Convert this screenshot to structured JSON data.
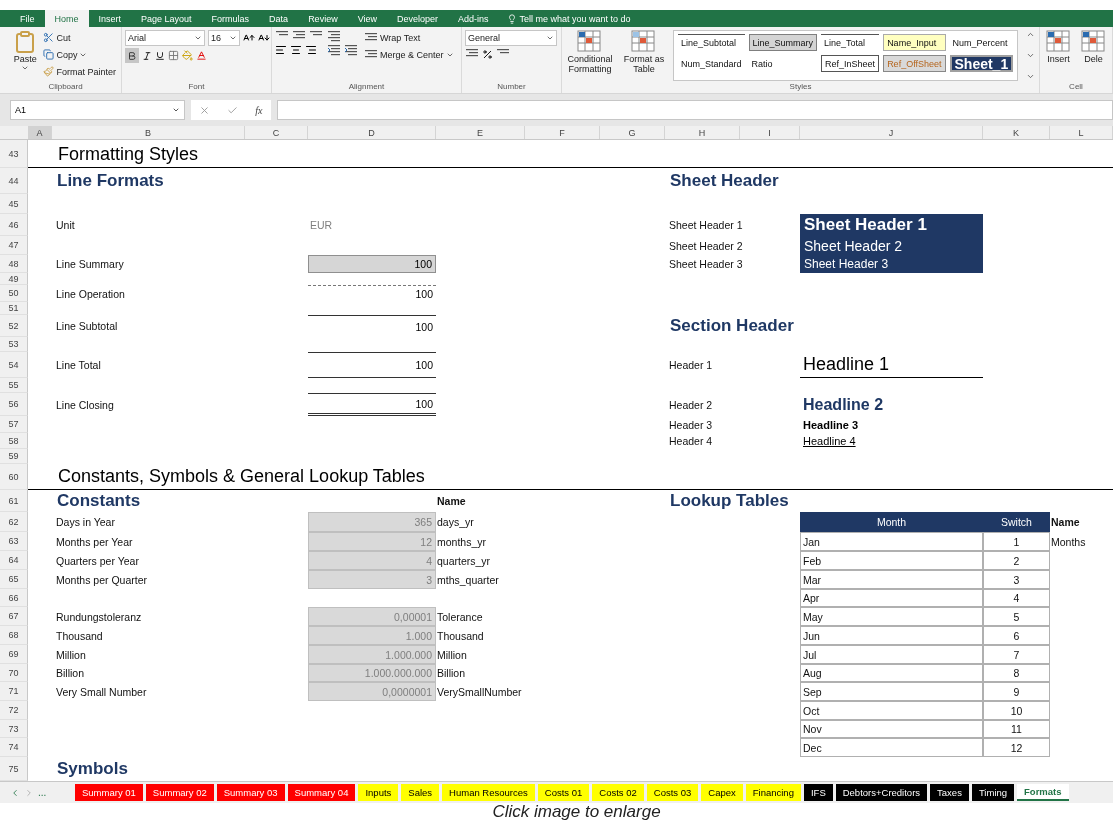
{
  "ribbon": {
    "tabs": [
      {
        "label": "File",
        "selected": false
      },
      {
        "label": "Home",
        "selected": true
      },
      {
        "label": "Insert",
        "selected": false
      },
      {
        "label": "Page Layout",
        "selected": false
      },
      {
        "label": "Formulas",
        "selected": false
      },
      {
        "label": "Data",
        "selected": false
      },
      {
        "label": "Review",
        "selected": false
      },
      {
        "label": "View",
        "selected": false
      },
      {
        "label": "Developer",
        "selected": false
      },
      {
        "label": "Add-ins",
        "selected": false
      }
    ],
    "tell_me": "Tell me what you want to do",
    "clipboard": {
      "paste": "Paste",
      "cut": "Cut",
      "copy": "Copy",
      "format_painter": "Format Painter",
      "label": "Clipboard"
    },
    "font": {
      "name": "Arial",
      "size": "16",
      "bold": true,
      "label": "Font"
    },
    "alignment": {
      "wrap": "Wrap Text",
      "merge": "Merge & Center",
      "label": "Alignment"
    },
    "number": {
      "format": "General",
      "label": "Number"
    },
    "styles": {
      "conditional": "Conditional Formatting",
      "format_table": "Format as Table",
      "label": "Styles",
      "gallery": [
        {
          "label": "Line_Subtotal",
          "kind": "topline"
        },
        {
          "label": "Line_Summary",
          "kind": "grey"
        },
        {
          "label": "Line_Total",
          "kind": "topline"
        },
        {
          "label": "Name_Input",
          "kind": "input"
        },
        {
          "label": "Num_Percent",
          "kind": "plain"
        },
        {
          "label": "Num_Standard",
          "kind": "plain"
        },
        {
          "label": "Ratio",
          "kind": "plain"
        },
        {
          "label": "Ref_InSheet",
          "kind": "boxed"
        },
        {
          "label": "Ref_OffSheet",
          "kind": "offsheet"
        },
        {
          "label": "Sheet_1",
          "kind": "sheet"
        }
      ]
    },
    "cells": {
      "insert": "Insert",
      "delete": "Dele",
      "label": "Cell"
    }
  },
  "formula_bar": {
    "name_box": "A1",
    "fx": "fx"
  },
  "columns": [
    "A",
    "B",
    "C",
    "D",
    "E",
    "F",
    "G",
    "H",
    "I",
    "J",
    "K",
    "L"
  ],
  "rows": [
    {
      "num": "43",
      "A": {
        "kind": "title",
        "text": "Formatting Styles"
      }
    },
    {
      "num": "44",
      "B": {
        "kind": "heading",
        "text": "Line Formats"
      },
      "H": {
        "kind": "heading",
        "text": "Sheet Header"
      }
    },
    {
      "num": "45"
    },
    {
      "num": "46",
      "B": {
        "kind": "label",
        "text": "Unit"
      },
      "D": {
        "kind": "unit",
        "text": "EUR"
      },
      "H": {
        "kind": "label",
        "text": "Sheet Header 1"
      },
      "J": {
        "kind": "sheet1",
        "text": "Sheet Header 1"
      }
    },
    {
      "num": "47",
      "H": {
        "kind": "label",
        "text": "Sheet Header 2"
      },
      "J": {
        "kind": "sheet2",
        "text": "Sheet Header 2"
      }
    },
    {
      "num": "48",
      "B": {
        "kind": "label",
        "text": "Line Summary"
      },
      "D": {
        "kind": "summary",
        "text": "100"
      },
      "H": {
        "kind": "label",
        "text": "Sheet Header 3"
      },
      "J": {
        "kind": "sheet3",
        "text": "Sheet Header 3"
      }
    },
    {
      "num": "49"
    },
    {
      "num": "50",
      "B": {
        "kind": "label",
        "text": "Line Operation"
      },
      "D": {
        "kind": "operation",
        "text": "100"
      }
    },
    {
      "num": "51"
    },
    {
      "num": "52",
      "B": {
        "kind": "label",
        "text": "Line Subtotal"
      },
      "D": {
        "kind": "subtotal",
        "text": "100"
      },
      "H": {
        "kind": "heading",
        "text": "Section Header"
      }
    },
    {
      "num": "53"
    },
    {
      "num": "54",
      "B": {
        "kind": "label",
        "text": "Line Total"
      },
      "D": {
        "kind": "total",
        "text": "100"
      },
      "H": {
        "kind": "label",
        "text": "Header 1"
      },
      "J": {
        "kind": "headline1",
        "text": "Headline 1"
      }
    },
    {
      "num": "55"
    },
    {
      "num": "56",
      "B": {
        "kind": "label",
        "text": "Line Closing"
      },
      "D": {
        "kind": "closing",
        "text": "100"
      },
      "H": {
        "kind": "label",
        "text": "Header 2"
      },
      "J": {
        "kind": "headline2",
        "text": "Headline 2"
      }
    },
    {
      "num": "57",
      "H": {
        "kind": "label",
        "text": "Header 3"
      },
      "J": {
        "kind": "headline3",
        "text": "Headline 3"
      }
    },
    {
      "num": "58",
      "H": {
        "kind": "label",
        "text": "Header 4"
      },
      "J": {
        "kind": "headline4",
        "text": "Headline 4"
      }
    },
    {
      "num": "59"
    },
    {
      "num": "60",
      "A": {
        "kind": "title",
        "text": "Constants, Symbols & General Lookup Tables"
      }
    },
    {
      "num": "61",
      "B": {
        "kind": "heading",
        "text": "Constants"
      },
      "E": {
        "kind": "bold",
        "text": "Name"
      },
      "H": {
        "kind": "heading",
        "text": "Lookup Tables"
      }
    },
    {
      "num": "62",
      "B": {
        "kind": "label",
        "text": "Days in Year"
      },
      "D": {
        "kind": "constant",
        "text": "365"
      },
      "E": {
        "kind": "name",
        "text": "days_yr"
      },
      "J": {
        "kind": "thead",
        "text": "Month"
      },
      "K": {
        "kind": "thead",
        "text": "Switch"
      },
      "L": {
        "kind": "bold",
        "text": "Name"
      }
    },
    {
      "num": "63",
      "B": {
        "kind": "label",
        "text": "Months per Year"
      },
      "D": {
        "kind": "constant",
        "text": "12"
      },
      "E": {
        "kind": "name",
        "text": "months_yr"
      },
      "J": {
        "kind": "tcell",
        "text": "Jan"
      },
      "K": {
        "kind": "tnum",
        "text": "1"
      },
      "L": {
        "kind": "name",
        "text": "Months"
      }
    },
    {
      "num": "64",
      "B": {
        "kind": "label",
        "text": "Quarters per Year"
      },
      "D": {
        "kind": "constant",
        "text": "4"
      },
      "E": {
        "kind": "name",
        "text": "quarters_yr"
      },
      "J": {
        "kind": "tcell",
        "text": "Feb"
      },
      "K": {
        "kind": "tnum",
        "text": "2"
      }
    },
    {
      "num": "65",
      "B": {
        "kind": "label",
        "text": "Months per Quarter"
      },
      "D": {
        "kind": "constant",
        "text": "3"
      },
      "E": {
        "kind": "name",
        "text": "mths_quarter"
      },
      "J": {
        "kind": "tcell",
        "text": "Mar"
      },
      "K": {
        "kind": "tnum",
        "text": "3"
      }
    },
    {
      "num": "66",
      "J": {
        "kind": "tcell",
        "text": "Apr"
      },
      "K": {
        "kind": "tnum",
        "text": "4"
      }
    },
    {
      "num": "67",
      "B": {
        "kind": "label",
        "text": "Rundungstoleranz"
      },
      "D": {
        "kind": "constant",
        "text": "0,00001"
      },
      "E": {
        "kind": "name",
        "text": "Tolerance"
      },
      "J": {
        "kind": "tcell",
        "text": "May"
      },
      "K": {
        "kind": "tnum",
        "text": "5"
      }
    },
    {
      "num": "68",
      "B": {
        "kind": "label",
        "text": "Thousand"
      },
      "D": {
        "kind": "constant",
        "text": "1.000"
      },
      "E": {
        "kind": "name",
        "text": "Thousand"
      },
      "J": {
        "kind": "tcell",
        "text": "Jun"
      },
      "K": {
        "kind": "tnum",
        "text": "6"
      }
    },
    {
      "num": "69",
      "B": {
        "kind": "label",
        "text": "Million"
      },
      "D": {
        "kind": "constant",
        "text": "1.000.000"
      },
      "E": {
        "kind": "name",
        "text": "Million"
      },
      "J": {
        "kind": "tcell",
        "text": "Jul"
      },
      "K": {
        "kind": "tnum",
        "text": "7"
      }
    },
    {
      "num": "70",
      "B": {
        "kind": "label",
        "text": "Billion"
      },
      "D": {
        "kind": "constant",
        "text": "1.000.000.000"
      },
      "E": {
        "kind": "name",
        "text": "Billion"
      },
      "J": {
        "kind": "tcell",
        "text": "Aug"
      },
      "K": {
        "kind": "tnum",
        "text": "8"
      }
    },
    {
      "num": "71",
      "B": {
        "kind": "label",
        "text": "Very Small Number"
      },
      "D": {
        "kind": "constant",
        "text": "0,0000001"
      },
      "E": {
        "kind": "name",
        "text": "VerySmallNumber"
      },
      "J": {
        "kind": "tcell",
        "text": "Sep"
      },
      "K": {
        "kind": "tnum",
        "text": "9"
      }
    },
    {
      "num": "72",
      "J": {
        "kind": "tcell",
        "text": "Oct"
      },
      "K": {
        "kind": "tnum",
        "text": "10"
      }
    },
    {
      "num": "73",
      "J": {
        "kind": "tcell",
        "text": "Nov"
      },
      "K": {
        "kind": "tnum",
        "text": "11"
      }
    },
    {
      "num": "74",
      "J": {
        "kind": "tcell",
        "text": "Dec"
      },
      "K": {
        "kind": "tnum",
        "text": "12"
      }
    },
    {
      "num": "75",
      "B": {
        "kind": "heading",
        "text": "Symbols"
      }
    }
  ],
  "sheet_tabs": {
    "more": "...",
    "tabs": [
      {
        "label": "Summary 01",
        "color": "#ff0000",
        "selected": false
      },
      {
        "label": "Summary 02",
        "color": "#ff0000",
        "selected": false
      },
      {
        "label": "Summary 03",
        "color": "#ff0000",
        "selected": false
      },
      {
        "label": "Summary 04",
        "color": "#ff0000",
        "selected": false
      },
      {
        "label": "Inputs",
        "color": "#ffff00",
        "selected": false
      },
      {
        "label": "Sales",
        "color": "#ffff00",
        "selected": false
      },
      {
        "label": "Human Resources",
        "color": "#ffff00",
        "selected": false
      },
      {
        "label": "Costs 01",
        "color": "#ffff00",
        "selected": false
      },
      {
        "label": "Costs 02",
        "color": "#ffff00",
        "selected": false
      },
      {
        "label": "Costs 03",
        "color": "#ffff00",
        "selected": false
      },
      {
        "label": "Capex",
        "color": "#ffff00",
        "selected": false
      },
      {
        "label": "Financing",
        "color": "#ffff00",
        "selected": false
      },
      {
        "label": "IFS",
        "color": "#000000",
        "selected": false
      },
      {
        "label": "Debtors+Creditors",
        "color": "#000000",
        "selected": false
      },
      {
        "label": "Taxes",
        "color": "#000000",
        "selected": false
      },
      {
        "label": "Timing",
        "color": "#000000",
        "selected": false
      },
      {
        "label": "Formats",
        "color": "#ffffff",
        "selected": true
      }
    ]
  },
  "caption": "Click image to enlarge"
}
